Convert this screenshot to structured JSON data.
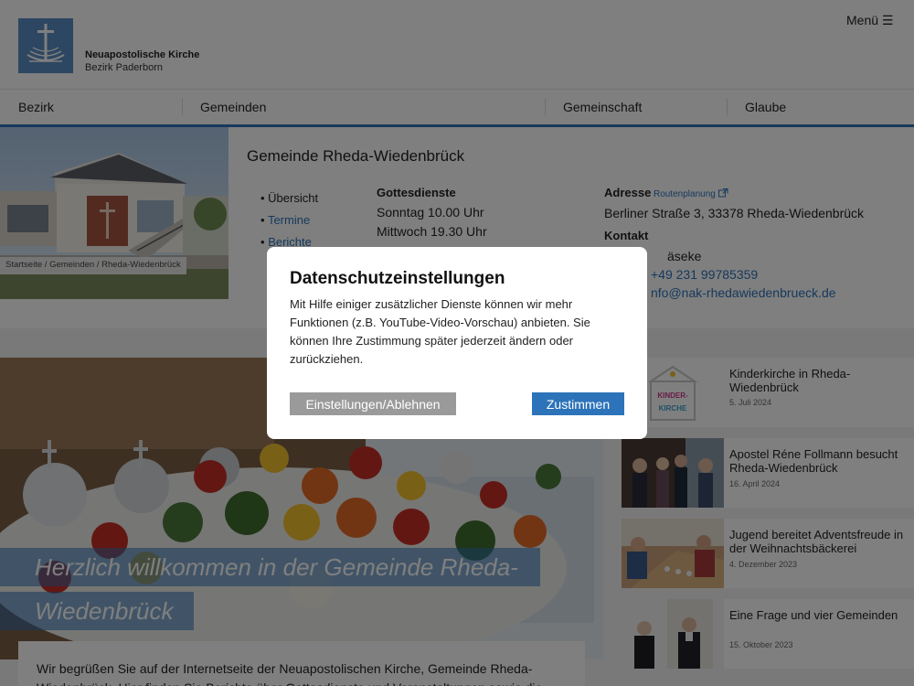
{
  "header": {
    "org_name": "Neuapostolische Kirche",
    "org_sub": "Bezirk Paderborn",
    "menu_label": "Menü ☰"
  },
  "nav": {
    "items": [
      {
        "label": "Bezirk"
      },
      {
        "label": "Gemeinden"
      },
      {
        "label": "Gemeinschaft"
      },
      {
        "label": "Glaube"
      }
    ]
  },
  "breadcrumb": {
    "items": [
      "Startseite",
      "Gemeinden",
      "Rheda-Wiedenbrück"
    ],
    "sep": " / "
  },
  "gemeinde": {
    "title": "Gemeinde Rheda-Wiedenbrück",
    "subnav": [
      {
        "label": "Übersicht"
      },
      {
        "label": "Termine"
      },
      {
        "label": "Berichte"
      }
    ],
    "gottesdienste": {
      "heading": "Gottesdienste",
      "lines": [
        "Sonntag 10.00 Uhr",
        "Mittwoch 19.30 Uhr"
      ]
    },
    "adresse": {
      "heading": "Adresse",
      "routen_label": "Routenplanung",
      "line": "Berliner Straße 3, 33378 Rheda-Wiedenbrück"
    },
    "kontakt": {
      "heading": "Kontakt",
      "name_partial": "äseke",
      "phone_partial": "+49 231 99785359",
      "email_partial": "nfo@nak-rhedawiedenbrueck.de"
    }
  },
  "hero": {
    "title_line1": "Herzlich willkommen in der Gemeinde Rheda-",
    "title_line2": "Wiedenbrück",
    "welcome_line1": "Wir begrüßen Sie auf der Internetseite der Neuapostolischen Kirche, Gemeinde Rheda-",
    "welcome_line2": "Wiedenbrück. Hier finden Sie Berichte über Gottesdienste und Veranstaltungen sowie die"
  },
  "news": [
    {
      "title": "Kinderkirche in Rheda-Wiedenbrück",
      "date": "5. Juli 2024",
      "thumb_sign_1": "KINDER-",
      "thumb_sign_2": "KIRCHE"
    },
    {
      "title": "Apostel Réne Follmann besucht Rheda-Wiedenbrück",
      "date": "16. April 2024"
    },
    {
      "title": "Jugend bereitet Adventsfreude in der Weihnachtsbäckerei",
      "date": "4. Dezember 2023"
    },
    {
      "title": "Eine Frage und vier Gemeinden",
      "date": "15. Oktober 2023"
    }
  ],
  "modal": {
    "title": "Datenschutzeinstellungen",
    "text": "Mit Hilfe einiger zusätzlicher Dienste können wir mehr Funktionen (z.B. YouTube-Video-Vorschau) anbieten. Sie können Ihre Zustimmung später jederzeit ändern oder zurückziehen.",
    "decline_label": "Einstellungen/Ablehnen",
    "accept_label": "Zustimmen"
  },
  "colors": {
    "brand_blue": "#2d73b9",
    "logo_blue": "#5b8fc4",
    "button_gray": "#9a9a9a"
  }
}
